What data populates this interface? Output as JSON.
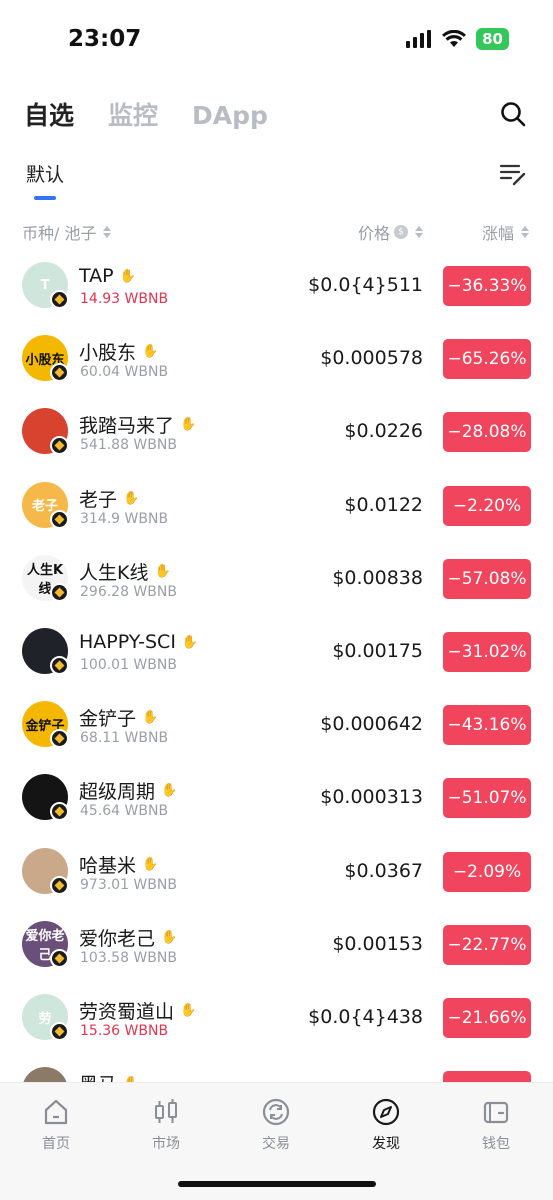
{
  "status": {
    "time": "23:07",
    "battery": "80"
  },
  "top_tabs": [
    "自选",
    "监控",
    "DApp"
  ],
  "sub_tab": "默认",
  "columns": {
    "token": "币种/ 池子",
    "price": "价格",
    "change": "涨幅"
  },
  "tokens": [
    {
      "name": "TAP",
      "pool": "14.93 WBNB",
      "pool_red": true,
      "price": "$0.0{4}511",
      "change": "−36.33%",
      "avatar_text": "T",
      "avatar_bg": "#cfe6dc",
      "avatar_color": "#ffffff"
    },
    {
      "name": "小股东",
      "pool": "60.04 WBNB",
      "pool_red": false,
      "price": "$0.000578",
      "change": "−65.26%",
      "avatar_text": "小股东",
      "avatar_bg": "#f5b800",
      "avatar_color": "#111111"
    },
    {
      "name": "我踏马来了",
      "pool": "541.88 WBNB",
      "pool_red": false,
      "price": "$0.0226",
      "change": "−28.08%",
      "avatar_text": "",
      "avatar_bg": "#d8432f",
      "avatar_color": "#ffffff"
    },
    {
      "name": "老子",
      "pool": "314.9 WBNB",
      "pool_red": false,
      "price": "$0.0122",
      "change": "−2.20%",
      "avatar_text": "老子",
      "avatar_bg": "#f7b84a",
      "avatar_color": "#ffffff"
    },
    {
      "name": "人生K线",
      "pool": "296.28 WBNB",
      "pool_red": false,
      "price": "$0.00838",
      "change": "−57.08%",
      "avatar_text": "人生K线",
      "avatar_bg": "#f4f4f4",
      "avatar_color": "#111111"
    },
    {
      "name": "HAPPY-SCI",
      "pool": "100.01 WBNB",
      "pool_red": false,
      "price": "$0.00175",
      "change": "−31.02%",
      "avatar_text": "",
      "avatar_bg": "#1f2228",
      "avatar_color": "#ffffff"
    },
    {
      "name": "金铲子",
      "pool": "68.11 WBNB",
      "pool_red": false,
      "price": "$0.000642",
      "change": "−43.16%",
      "avatar_text": "金铲子",
      "avatar_bg": "#f5b800",
      "avatar_color": "#111111"
    },
    {
      "name": "超级周期",
      "pool": "45.64 WBNB",
      "pool_red": false,
      "price": "$0.000313",
      "change": "−51.07%",
      "avatar_text": "",
      "avatar_bg": "#141414",
      "avatar_color": "#d9b24a"
    },
    {
      "name": "哈基米",
      "pool": "973.01 WBNB",
      "pool_red": false,
      "price": "$0.0367",
      "change": "−2.09%",
      "avatar_text": "",
      "avatar_bg": "#c9a98a",
      "avatar_color": "#ffffff"
    },
    {
      "name": "爱你老己",
      "pool": "103.58 WBNB",
      "pool_red": false,
      "price": "$0.00153",
      "change": "−22.77%",
      "avatar_text": "爱你老己",
      "avatar_bg": "#6a4f7a",
      "avatar_color": "#ffffff"
    },
    {
      "name": "劳资蜀道山",
      "pool": "15.36 WBNB",
      "pool_red": true,
      "price": "$0.0{4}438",
      "change": "−21.66%",
      "avatar_text": "劳",
      "avatar_bg": "#cfe6dc",
      "avatar_color": "#ffffff"
    },
    {
      "name": "黑马",
      "pool": "",
      "pool_red": false,
      "price": "",
      "change": "",
      "avatar_text": "",
      "avatar_bg": "#8a7a66",
      "avatar_color": "#ffffff"
    }
  ],
  "nav": [
    "首页",
    "市场",
    "交易",
    "发现",
    "钱包"
  ],
  "colors": {
    "accent": "#3375f6",
    "down": "#f0455d",
    "battery": "#34c759"
  }
}
